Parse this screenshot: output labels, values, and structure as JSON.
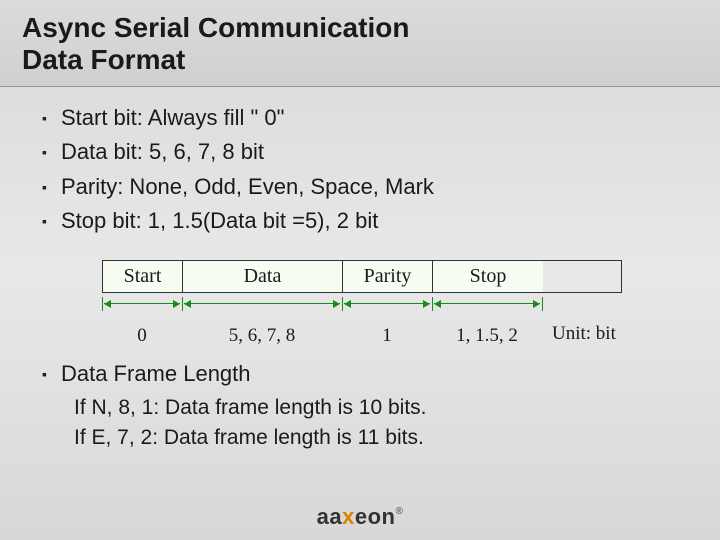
{
  "title_line1": "Async Serial Communication",
  "title_line2": "Data Format",
  "bullets": [
    "Start bit: Always fill \" 0\"",
    "Data bit: 5, 6, 7, 8 bit",
    "Parity: None, Odd, Even, Space, Mark",
    "Stop bit: 1, 1.5(Data bit =5), 2 bit"
  ],
  "diagram": {
    "headers": {
      "start": "Start",
      "data": "Data",
      "parity": "Parity",
      "stop": "Stop"
    },
    "values": {
      "start": "0",
      "data": "5, 6, 7, 8",
      "parity": "1",
      "stop": "1, 1.5, 2"
    },
    "unit": "Unit: bit"
  },
  "sub_heading": "Data Frame Length",
  "examples": [
    "If N, 8, 1: Data frame length is 10 bits.",
    "If E, 7, 2: Data frame length is 11 bits."
  ],
  "logo": {
    "pre": "aa",
    "mid": "x",
    "post": "eon"
  }
}
